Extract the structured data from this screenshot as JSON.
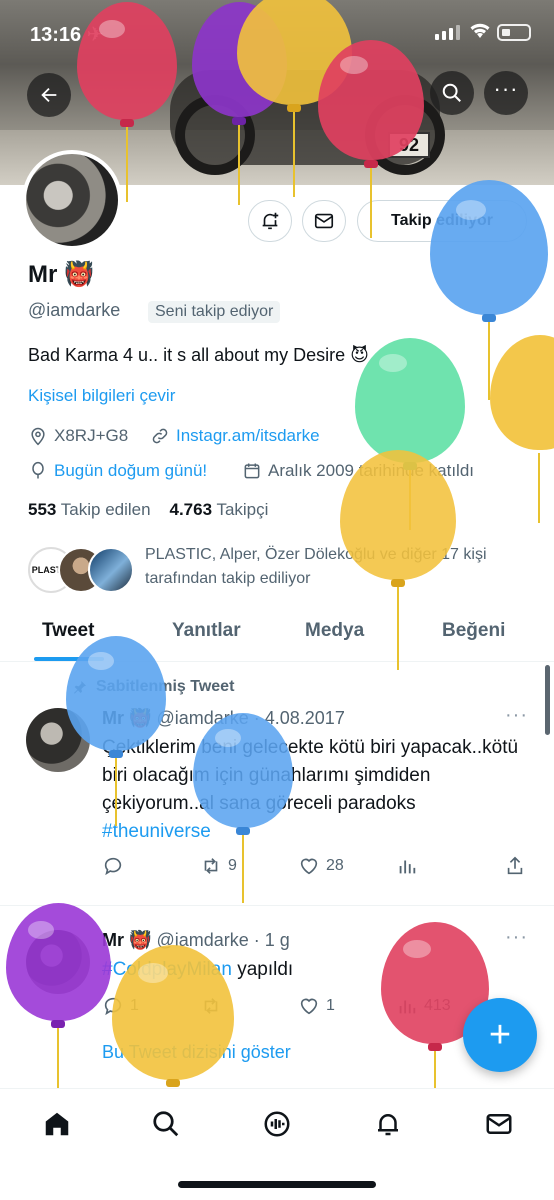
{
  "status_bar": {
    "time": "13:16"
  },
  "banner": {
    "plate_text": "92"
  },
  "profile": {
    "name": "Mr",
    "name_emoji": "👹",
    "handle": "@iamdarke",
    "follows_you": "Seni takip ediyor",
    "bio": "Bad Karma 4 u.. it s all about my Desire",
    "bio_emoji": "😈",
    "translate_label": "Kişisel bilgileri çevir",
    "location": "X8RJ+G8",
    "link": "Instagr.am/itsdarke",
    "birthday": "Bugün doğum günü!",
    "joined": "Aralık 2009 tarihinde katıldı",
    "following_count": "553",
    "following_label": "Takip edilen",
    "followers_count": "4.763",
    "followers_label": "Takipçi",
    "followed_by": "PLASTIC, Alper, Özer Dölekoğlu ve diğer 17 kişi tarafından takip ediliyor",
    "mini_avatar_text": "PLASTIC"
  },
  "buttons": {
    "follow_state": "Takip ediliyor"
  },
  "tabs": [
    "Tweet",
    "Yanıtlar",
    "Medya",
    "Beğeni"
  ],
  "tweets": [
    {
      "pinned_label": "Sabitlenmiş Tweet",
      "name": "Mr",
      "emoji": "👹",
      "handle_date": "@iamdarke · 4.08.2017",
      "text": "Çektiklerim beni gelecekte kötü biri yapacak..kötü biri olacağım için günahlarımı şimdiden çekiyorum..al sana göreceli paradoks",
      "hashtag": "#theuniverse",
      "replies": "",
      "retweets": "9",
      "likes": "28"
    },
    {
      "name": "Mr",
      "emoji": "👹",
      "handle_date": "@iamdarke · 1 g",
      "hashtag": "#ColdplayMilan",
      "text": "yapıldı",
      "replies": "1",
      "retweets": "",
      "likes": "1",
      "views": "413",
      "thread_link": "Bu Tweet dizisini göster"
    }
  ],
  "colors": {
    "accent": "#1d9bf0",
    "text": "#0f1419",
    "secondary": "#536471"
  }
}
